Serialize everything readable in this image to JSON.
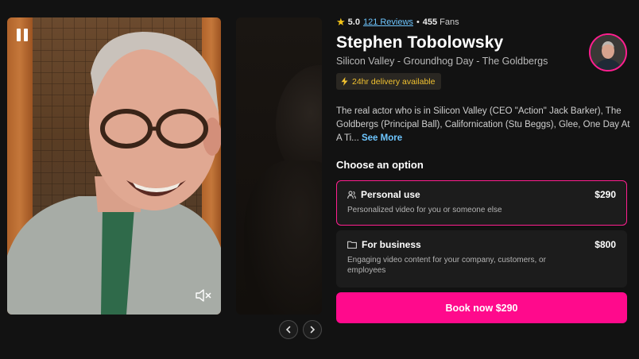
{
  "rating": {
    "score": "5.0",
    "reviews": "121 Reviews",
    "separator": "•",
    "fans_count": "455",
    "fans_label": "Fans",
    "star_color": "#f5c518"
  },
  "talent": {
    "name": "Stephen Tobolowsky",
    "tags": "Silicon Valley - Groundhog Day - The Goldbergs"
  },
  "delivery": {
    "label": "24hr delivery available",
    "icon": "lightning-icon"
  },
  "bio": {
    "text": "The real actor who is in Silicon Valley (CEO \"Action\" Jack Barker), The Goldbergs (Principal Ball), Californication (Stu Beggs), Glee, One Day At A Ti...",
    "see_more": "See More"
  },
  "options": {
    "heading": "Choose an option",
    "items": [
      {
        "title": "Personal use",
        "price": "$290",
        "description": "Personalized video for you or someone else",
        "icon": "people-icon",
        "selected": true
      },
      {
        "title": "For business",
        "price": "$800",
        "description": "Engaging video content for your company, customers, or employees",
        "icon": "folder-icon",
        "selected": false
      }
    ]
  },
  "cta": {
    "label": "Book now $290",
    "color": "#ff0a8c"
  },
  "video": {
    "pause_icon": "pause-icon",
    "mute_icon": "muted-speaker-icon"
  },
  "carousel": {
    "prev_icon": "chevron-left-icon",
    "next_icon": "chevron-right-icon"
  },
  "colors": {
    "accent": "#ff1f8f",
    "link": "#6ec6ff",
    "background": "#121212"
  }
}
